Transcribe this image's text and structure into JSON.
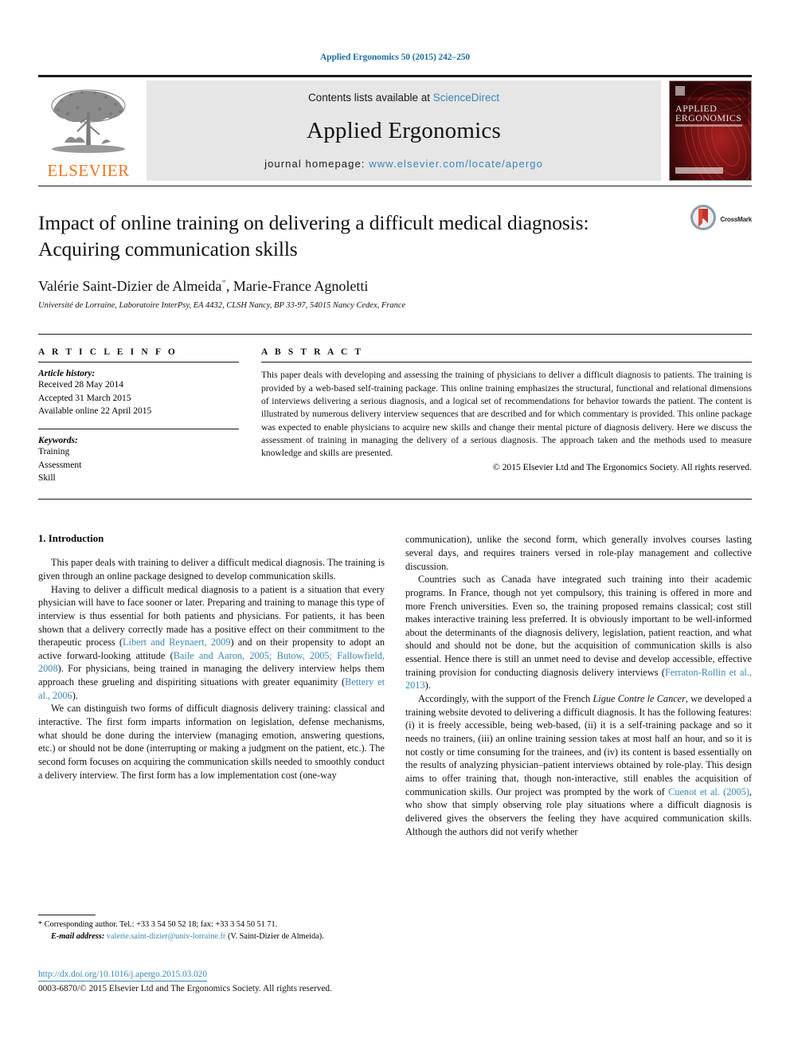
{
  "running_head": "Applied Ergonomics 50 (2015) 242–250",
  "journal_header": {
    "publisher_logo_text": "ELSEVIER",
    "contents_prefix": "Contents lists available at ",
    "contents_link": "ScienceDirect",
    "journal_title": "Applied Ergonomics",
    "homepage_prefix": "journal homepage: ",
    "homepage_link": "www.elsevier.com/locate/apergo",
    "cover_title_line1": "APPLIED",
    "cover_title_line2": "ERGONOMICS"
  },
  "article": {
    "title": "Impact of online training on delivering a difficult medical diagnosis: Acquiring communication skills",
    "authors_part1": "Valérie Saint-Dizier de Almeida",
    "authors_marker": "*",
    "authors_part2": ", Marie-France Agnoletti",
    "affiliation": "Université de Lorraine, Laboratoire InterPsy, EA 4432, CLSH Nancy, BP 33-97, 54015 Nancy Cedex, France",
    "crossmark_label": "CrossMark"
  },
  "article_info": {
    "heading": "A R T I C L E   I N F O",
    "history_label": "Article history:",
    "history_lines": [
      "Received 28 May 2014",
      "Accepted 31 March 2015",
      "Available online 22 April 2015"
    ],
    "keywords_label": "Keywords:",
    "keywords": [
      "Training",
      "Assessment",
      "Skill"
    ]
  },
  "abstract": {
    "heading": "A B S T R A C T",
    "text": "This paper deals with developing and assessing the training of physicians to deliver a difficult diagnosis to patients. The training is provided by a web-based self-training package. This online training emphasizes the structural, functional and relational dimensions of interviews delivering a serious diagnosis, and a logical set of recommendations for behavior towards the patient. The content is illustrated by numerous delivery interview sequences that are described and for which commentary is provided. This online package was expected to enable physicians to acquire new skills and change their mental picture of diagnosis delivery. Here we discuss the assessment of training in managing the delivery of a serious diagnosis. The approach taken and the methods used to measure knowledge and skills are presented.",
    "copyright": "© 2015 Elsevier Ltd and The Ergonomics Society. All rights reserved."
  },
  "body": {
    "section_title": "1.  Introduction",
    "left_paragraphs": [
      "This paper deals with training to deliver a difficult medical diagnosis. The training is given through an online package designed to develop communication skills.",
      "Having to deliver a difficult medical diagnosis to a patient is a situation that every physician will have to face sooner or later. Preparing and training to manage this type of interview is thus essential for both patients and physicians. For patients, it has been shown that a delivery correctly made has a positive effect on their commitment to the therapeutic process (Libert and Reynaert, 2009) and on their propensity to adopt an active forward-looking attitude (Baile and Aaron, 2005; Butow, 2005; Fallowfield, 2008). For physicians, being trained in managing the delivery interview helps them approach these grueling and dispiriting situations with greater equanimity (Bettery et al., 2006).",
      "We can distinguish two forms of difficult diagnosis delivery training: classical and interactive. The first form imparts information on legislation, defense mechanisms, what should be done during the interview (managing emotion, answering questions, etc.) or should not be done (interrupting or making a judgment on the patient, etc.). The second form focuses on acquiring the communication skills needed to smoothly conduct a delivery interview. The first form has a low implementation cost (one-way"
    ],
    "left_citations": [
      "Libert and Reynaert, 2009",
      "Baile and Aaron, 2005; Butow, 2005; Fallowfield, 2008",
      "Bettery et al., 2006"
    ],
    "right_paragraphs": [
      "communication), unlike the second form, which generally involves courses lasting several days, and requires trainers versed in role-play management and collective discussion.",
      "Countries such as Canada have integrated such training into their academic programs. In France, though not yet compulsory, this training is offered in more and more French universities. Even so, the training proposed remains classical; cost still makes interactive training less preferred. It is obviously important to be well-informed about the determinants of the diagnosis delivery, legislation, patient reaction, and what should and should not be done, but the acquisition of communication skills is also essential. Hence there is still an unmet need to devise and develop accessible, effective training provision for conducting diagnosis delivery interviews (Ferraton-Rollin et al., 2013).",
      "Accordingly, with the support of the French Ligue Contre le Cancer, we developed a training website devoted to delivering a difficult diagnosis. It has the following features: (i) it is freely accessible, being web-based, (ii) it is a self-training package and so it needs no trainers, (iii) an online training session takes at most half an hour, and so it is not costly or time consuming for the trainees, and (iv) its content is based essentially on the results of analyzing physician–patient interviews obtained by role-play. This design aims to offer training that, though non-interactive, still enables the acquisition of communication skills. Our project was prompted by the work of Cuenot et al. (2005), who show that simply observing role play situations where a difficult diagnosis is delivered gives the observers the feeling they have acquired communication skills. Although the authors did not verify whether"
    ],
    "right_citations": [
      "Ferraton-Rollin et al., 2013",
      "Cuenot et al. (2005)"
    ],
    "right_italics": [
      "Ligue Contre le Cancer"
    ]
  },
  "footnote": {
    "marker": "*",
    "corresponding": "Corresponding author. Tel.: +33 3 54 50 52 18; fax: +33 3 54 50 51 71.",
    "email_label": "E-mail address:",
    "email": "valerie.saint-dizier@univ-lorraine.fr",
    "email_suffix": "(V. Saint-Dizier de Almeida)."
  },
  "footer": {
    "doi": "http://dx.doi.org/10.1016/j.apergo.2015.03.020",
    "issn_line": "0003-6870/© 2015 Elsevier Ltd and The Ergonomics Society. All rights reserved."
  },
  "colors": {
    "link": "#3a86b8",
    "elsevier_orange": "#E87722",
    "header_band": "#e6e6e6",
    "cover_red": "#7b1113"
  }
}
